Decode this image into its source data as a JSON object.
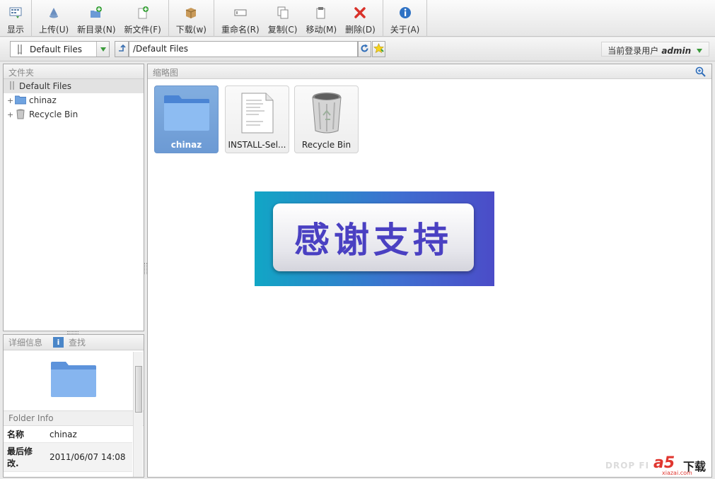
{
  "toolbar": {
    "display": "显示",
    "upload": "上传(U)",
    "new_folder": "新目录(N)",
    "new_file": "新文件(F)",
    "download": "下载(w)",
    "rename": "重命名(R)",
    "copy": "复制(C)",
    "move": "移动(M)",
    "delete": "删除(D)",
    "about": "关于(A)"
  },
  "addressbar": {
    "location": "Default Files",
    "path": "/Default Files",
    "user_label": "当前登录用户",
    "username": "admin"
  },
  "folders_panel": {
    "title": "文件夹",
    "root": "Default Files",
    "items": [
      {
        "label": "chinaz",
        "expander": "+"
      },
      {
        "label": "Recycle Bin",
        "expander": "+"
      }
    ]
  },
  "details_panel": {
    "tab_details": "详细信息",
    "tab_search": "查找",
    "folder_info_title": "Folder Info",
    "rows": [
      {
        "key": "名称",
        "value": "chinaz"
      },
      {
        "key": "最后修改.",
        "value": "2011/06/07 14:08"
      }
    ]
  },
  "thumbnails_panel": {
    "title": "缩略图",
    "tiles": [
      {
        "label": "chinaz",
        "icon": "folder-icon",
        "selected": true
      },
      {
        "label": "INSTALL-Sel...",
        "icon": "text-document-icon",
        "selected": false
      },
      {
        "label": "Recycle Bin",
        "icon": "trash-bin-icon",
        "selected": false
      }
    ]
  },
  "banner": {
    "text": "感谢支持"
  },
  "watermark": {
    "brand": "DROP FI",
    "logo": "a5",
    "logo_text": "下载",
    "logo_url": "xiazai.com"
  },
  "colors": {
    "accent": "#6c9ad4",
    "banner_text": "#4a40c2",
    "delete_red": "#d9322a"
  }
}
